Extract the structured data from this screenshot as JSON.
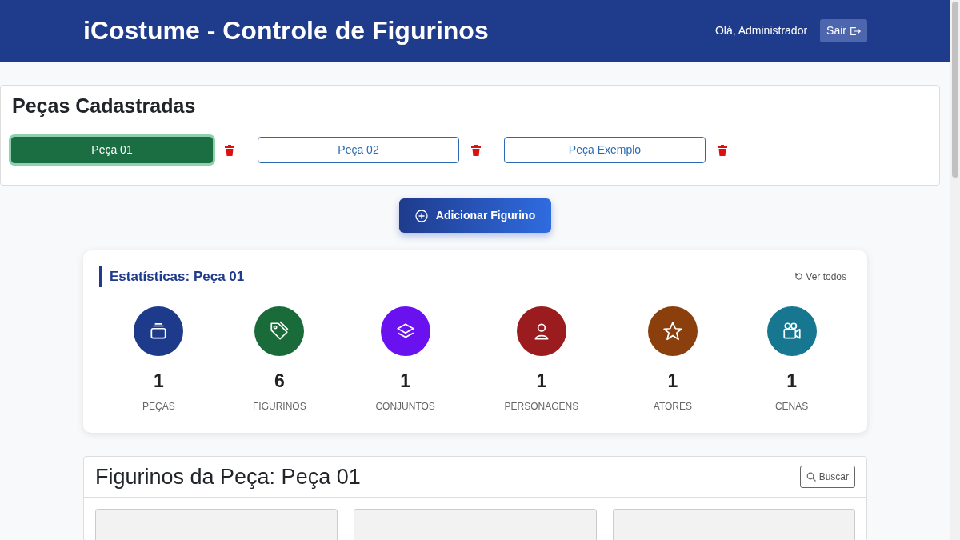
{
  "header": {
    "title": "iCostume - Controle de Figurinos",
    "greeting": "Olá, Administrador",
    "logout": "Sair"
  },
  "plays": {
    "title": "Peças Cadastradas",
    "items": [
      {
        "label": "Peça 01",
        "selected": true
      },
      {
        "label": "Peça 02",
        "selected": false
      },
      {
        "label": "Peça Exemplo",
        "selected": false
      }
    ]
  },
  "add_button": "Adicionar Figurino",
  "stats": {
    "title": "Estatísticas: Peça 01",
    "view_all": "Ver todos",
    "items": [
      {
        "kind": "plays",
        "value": "1",
        "label": "PEÇAS",
        "color": "#1e3a8a"
      },
      {
        "kind": "costumes",
        "value": "6",
        "label": "FIGURINOS",
        "color": "#1a6b3a"
      },
      {
        "kind": "sets",
        "value": "1",
        "label": "CONJUNTOS",
        "color": "#6a11f0"
      },
      {
        "kind": "characters",
        "value": "1",
        "label": "PERSONAGENS",
        "color": "#9b1c1f"
      },
      {
        "kind": "actors",
        "value": "1",
        "label": "ATORES",
        "color": "#8b3f0c"
      },
      {
        "kind": "scenes",
        "value": "1",
        "label": "CENAS",
        "color": "#177690"
      }
    ]
  },
  "costumes": {
    "title": "Figurinos da Peça: Peça 01",
    "search": "Buscar",
    "cards": [
      {
        "kind": "card"
      },
      {
        "kind": "card"
      },
      {
        "kind": "card"
      }
    ]
  }
}
